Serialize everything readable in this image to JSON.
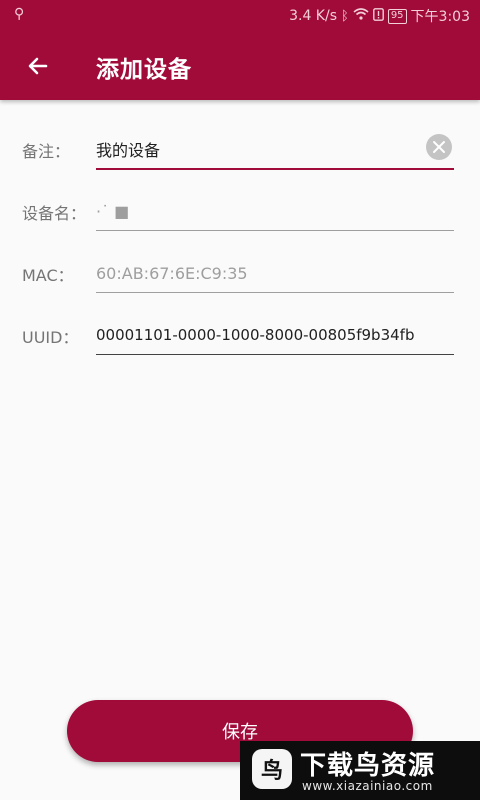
{
  "status_bar": {
    "usb_icon": "usb-icon",
    "speed": "3.4 K/s",
    "battery": "95",
    "time": "下午3:03"
  },
  "toolbar": {
    "title": "添加设备",
    "back_icon": "arrow-left-icon"
  },
  "form": {
    "note": {
      "label": "备注：",
      "value": "我的设备"
    },
    "device_name": {
      "label": "设备名：",
      "value": "·˙ ■"
    },
    "mac": {
      "label": "MAC：",
      "value": "60:AB:67:6E:C9:35"
    },
    "uuid": {
      "label": "UUID：",
      "value": "00001101-0000-1000-8000-00805f9b34fb"
    }
  },
  "save_button": {
    "label": "保存"
  },
  "watermark": {
    "title": "下载鸟资源",
    "url": "www.xiazainiao.com",
    "logo": "鸟"
  },
  "colors": {
    "accent": "#a00b3a",
    "underline": "#9e9e9e",
    "background": "#fafafa"
  }
}
